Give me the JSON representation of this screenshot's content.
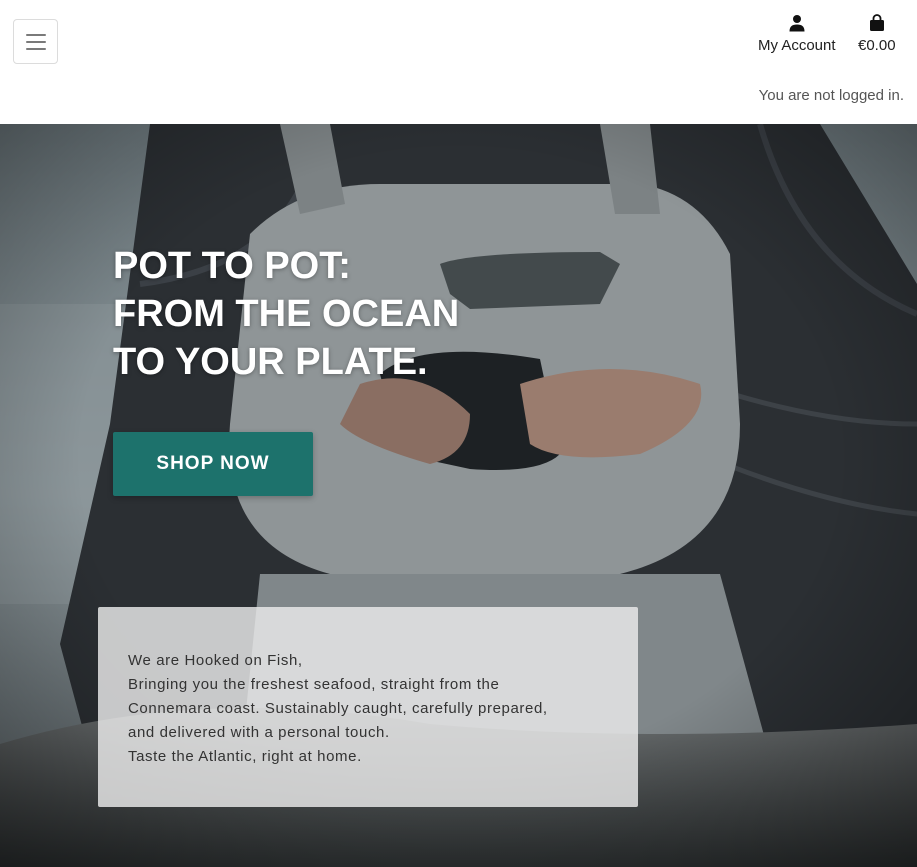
{
  "header": {
    "account_label": "My Account",
    "cart_total": "€0.00",
    "login_status": "You are not logged in."
  },
  "hero": {
    "title_lines": [
      "POT TO POT:",
      "FROM THE OCEAN",
      "TO YOUR PLATE."
    ],
    "cta_label": "SHOP NOW",
    "intro_lines": [
      "We are Hooked on Fish,",
      "Bringing you the freshest seafood, straight from the",
      "Connemara coast. Sustainably caught, carefully prepared,",
      "and delivered with a personal touch.",
      "Taste the Atlantic, right at home."
    ]
  },
  "icons": {
    "menu": "hamburger-menu-icon",
    "account": "user-icon",
    "cart": "shopping-bag-icon"
  },
  "colors": {
    "accent": "#1d726c",
    "text": "#222222"
  }
}
